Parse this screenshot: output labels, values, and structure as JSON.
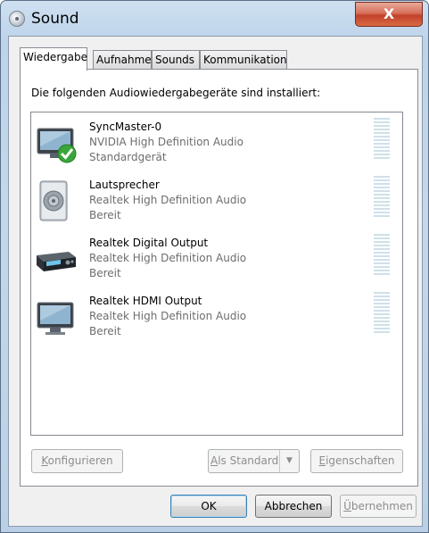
{
  "window": {
    "title": "Sound",
    "close_symbol": "X"
  },
  "tabs": [
    {
      "label": "Wiedergabe"
    },
    {
      "label": "Aufnahme"
    },
    {
      "label": "Sounds"
    },
    {
      "label": "Kommunikation"
    }
  ],
  "panel": {
    "intro": "Die folgenden Audiowiedergabegeräte sind installiert:"
  },
  "devices": [
    {
      "name": "SyncMaster-0",
      "driver": "NVIDIA High Definition Audio",
      "status": "Standardgerät",
      "icon": "monitor-default-icon"
    },
    {
      "name": "Lautsprecher",
      "driver": "Realtek High Definition Audio",
      "status": "Bereit",
      "icon": "speaker-icon"
    },
    {
      "name": "Realtek Digital Output",
      "driver": "Realtek High Definition Audio",
      "status": "Bereit",
      "icon": "digital-output-icon"
    },
    {
      "name": "Realtek HDMI Output",
      "driver": "Realtek High Definition Audio",
      "status": "Bereit",
      "icon": "monitor-icon"
    }
  ],
  "panel_buttons": {
    "configure": {
      "pre": "",
      "key": "K",
      "post": "onfigurieren"
    },
    "set_default": {
      "pre": "",
      "key": "A",
      "post": "ls Standard"
    },
    "properties": {
      "pre": "",
      "key": "E",
      "post": "igenschaften"
    }
  },
  "dialog_buttons": {
    "ok": "OK",
    "cancel": "Abbrechen",
    "apply": {
      "pre": "",
      "key": "Ü",
      "post": "bernehmen"
    }
  },
  "colors": {
    "meter_idle": "#cfe0ea",
    "check_green": "#3aa63a"
  }
}
